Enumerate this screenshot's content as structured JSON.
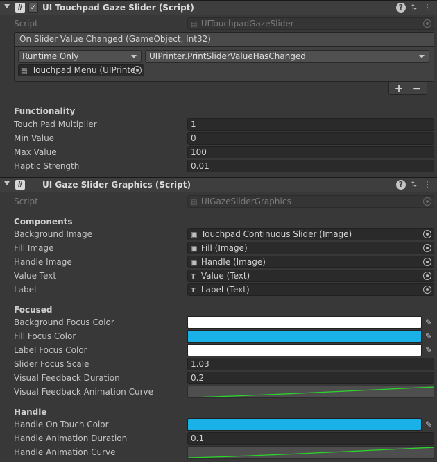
{
  "component1": {
    "title": "UI Touchpad Gaze Slider (Script)",
    "enabled": "✓",
    "script_label": "Script",
    "script_value": "UITouchpadGazeSlider",
    "event": {
      "header": "On Slider Value Changed (GameObject, Int32)",
      "runtime": "Runtime Only",
      "function": "UIPrinter.PrintSliderValueHasChanged",
      "target": "Touchpad Menu (UIPrinte"
    },
    "plus": "+",
    "minus": "−",
    "functionality": {
      "title": "Functionality",
      "fields": [
        {
          "label": "Touch Pad Multiplier",
          "value": "1"
        },
        {
          "label": "Min Value",
          "value": "0"
        },
        {
          "label": "Max Value",
          "value": "100"
        },
        {
          "label": "Haptic Strength",
          "value": "0.01"
        }
      ]
    }
  },
  "component2": {
    "title": "UI Gaze Slider Graphics (Script)",
    "script_label": "Script",
    "script_value": "UIGazeSliderGraphics",
    "components": {
      "title": "Components",
      "fields": [
        {
          "label": "Background Image",
          "value": "Touchpad Continuous Slider (Image)",
          "icon": "image-icon"
        },
        {
          "label": "Fill Image",
          "value": "Fill (Image)",
          "icon": "image-icon"
        },
        {
          "label": "Handle Image",
          "value": "Handle (Image)",
          "icon": "image-icon"
        },
        {
          "label": "Value Text",
          "value": "Value (Text)",
          "icon": "text-icon"
        },
        {
          "label": "Label",
          "value": "Label (Text)",
          "icon": "text-icon"
        }
      ]
    },
    "focused": {
      "title": "Focused",
      "background_focus_color": {
        "label": "Background Focus Color",
        "color": "#ffffff"
      },
      "fill_focus_color": {
        "label": "Fill Focus Color",
        "color": "#1ab0e8"
      },
      "label_focus_color": {
        "label": "Label Focus Color",
        "color": "#ffffff"
      },
      "slider_focus_scale": {
        "label": "Slider Focus Scale",
        "value": "1.03"
      },
      "visual_feedback_duration": {
        "label": "Visual Feedback Duration",
        "value": "0.2"
      },
      "visual_feedback_animation_curve": {
        "label": "Visual Feedback Animation Curve"
      }
    },
    "handle": {
      "title": "Handle",
      "handle_on_touch_color": {
        "label": "Handle On Touch Color",
        "color": "#1ab0e8"
      },
      "handle_animation_duration": {
        "label": "Handle Animation Duration",
        "value": "0.1"
      },
      "handle_animation_curve": {
        "label": "Handle Animation Curve"
      }
    }
  },
  "icons": {
    "script": "#",
    "help": "?",
    "presets": "⇅",
    "menu": "⋮",
    "image": "▣",
    "text": "T",
    "picker": "✎"
  },
  "colors": {
    "curve_line": "#2ad62a"
  }
}
